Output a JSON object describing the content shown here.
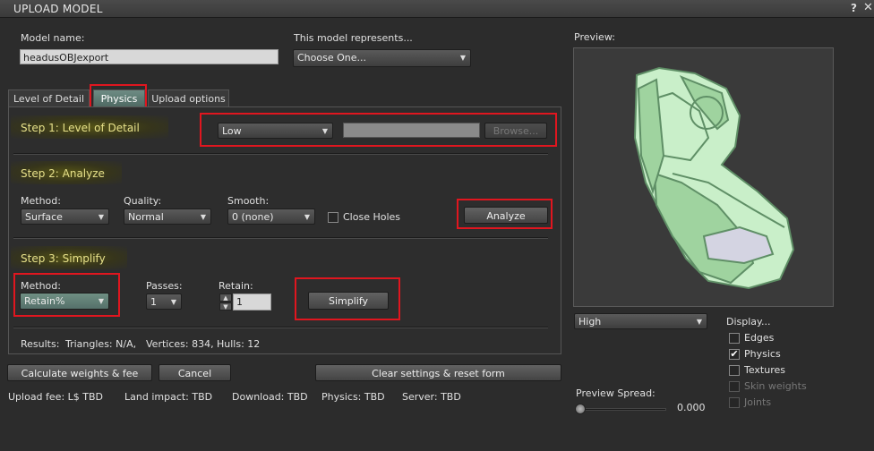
{
  "window": {
    "title": "UPLOAD MODEL",
    "help": "?",
    "close": "✕"
  },
  "model_name": {
    "label": "Model name:",
    "value": "headusOBJexport"
  },
  "represents": {
    "label": "This model represents...",
    "value": "Choose One..."
  },
  "tabs": [
    {
      "label": "Level of Detail"
    },
    {
      "label": "Physics"
    },
    {
      "label": "Upload options"
    }
  ],
  "step1": {
    "header": "Step 1: Level of Detail",
    "lod_value": "Low",
    "browse_label": "Browse..."
  },
  "step2": {
    "header": "Step 2: Analyze",
    "method_label": "Method:",
    "method_value": "Surface",
    "quality_label": "Quality:",
    "quality_value": "Normal",
    "smooth_label": "Smooth:",
    "smooth_value": "0 (none)",
    "close_holes_label": "Close Holes",
    "analyze_label": "Analyze"
  },
  "step3": {
    "header": "Step 3: Simplify",
    "method_label": "Method:",
    "method_value": "Retain%",
    "passes_label": "Passes:",
    "passes_value": "1",
    "retain_label": "Retain:",
    "retain_value": "1",
    "simplify_label": "Simplify"
  },
  "results": {
    "label": "Results:",
    "triangles": "Triangles: N/A,",
    "vertices": "Vertices: 834,",
    "hulls": "Hulls: 12"
  },
  "buttons": {
    "calculate": "Calculate weights & fee",
    "cancel": "Cancel",
    "clear": "Clear settings & reset form"
  },
  "fees": {
    "upload": "Upload fee: L$ TBD",
    "land": "Land impact: TBD",
    "download": "Download: TBD",
    "physics": "Physics: TBD",
    "server": "Server: TBD"
  },
  "preview": {
    "label": "Preview:",
    "lod_value": "High",
    "display_label": "Display...",
    "options": [
      {
        "label": "Edges",
        "checked": false,
        "enabled": true
      },
      {
        "label": "Physics",
        "checked": true,
        "enabled": true
      },
      {
        "label": "Textures",
        "checked": false,
        "enabled": true
      },
      {
        "label": "Skin weights",
        "checked": false,
        "enabled": false
      },
      {
        "label": "Joints",
        "checked": false,
        "enabled": false
      }
    ],
    "spread_label": "Preview Spread:",
    "spread_value": "0.000",
    "model_colors": {
      "light": "#c9efc9",
      "mid": "#9fd39f",
      "dark": "#5f8f66",
      "sole": "#d4d4e2"
    }
  },
  "icons": {
    "dropdown": "chevron-down-icon",
    "check": "checkmark-icon",
    "spin_up": "spin-up-icon",
    "spin_down": "spin-down-icon"
  }
}
